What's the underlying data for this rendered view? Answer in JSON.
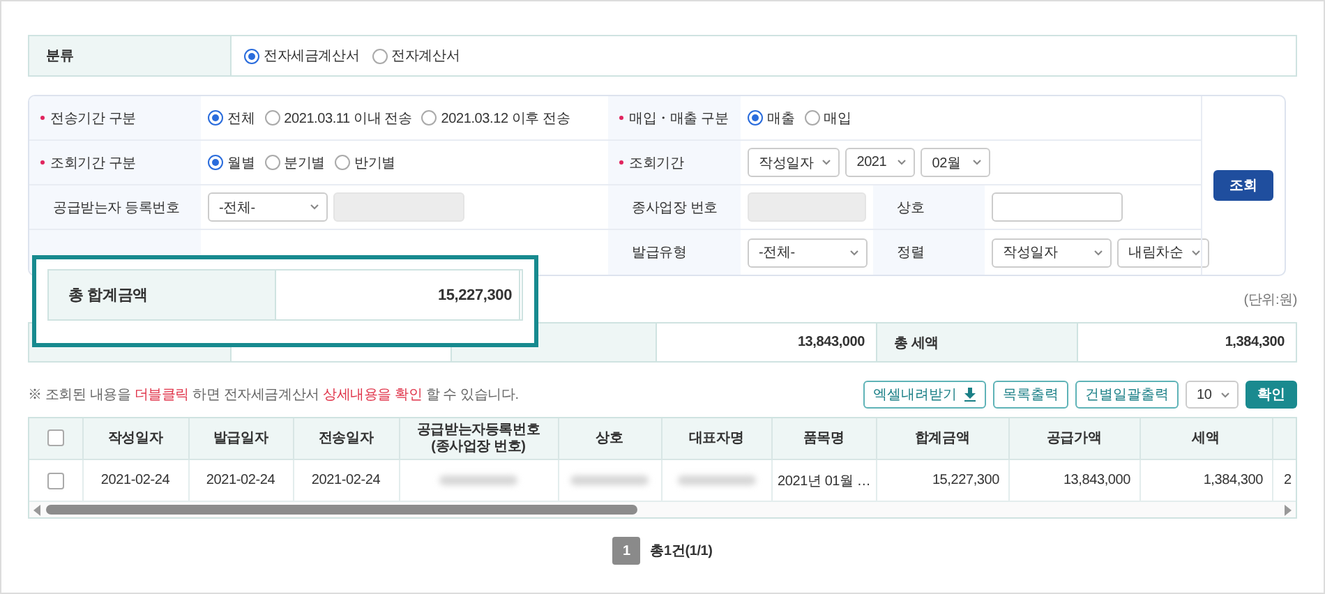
{
  "category": {
    "label": "분류",
    "options": [
      {
        "label": "전자세금계산서",
        "selected": true
      },
      {
        "label": "전자계산서",
        "selected": false
      }
    ]
  },
  "search": {
    "rows": [
      {
        "cells": [
          {
            "kind": "label",
            "text": "전송기간 구분",
            "required": true
          },
          {
            "kind": "value",
            "controls": [
              {
                "kind": "radio",
                "label": "전체",
                "selected": true
              },
              {
                "kind": "radio",
                "label": "2021.03.11 이내 전송",
                "selected": false
              },
              {
                "kind": "radio",
                "label": "2021.03.12 이후 전송",
                "selected": false
              }
            ]
          },
          {
            "kind": "label",
            "text": "매입・매출 구분",
            "required": true
          },
          {
            "kind": "value",
            "controls": [
              {
                "kind": "radio",
                "label": "매출",
                "selected": true
              },
              {
                "kind": "radio",
                "label": "매입",
                "selected": false
              }
            ]
          }
        ]
      },
      {
        "cells": [
          {
            "kind": "label",
            "text": "조회기간 구분",
            "required": true
          },
          {
            "kind": "value",
            "controls": [
              {
                "kind": "radio",
                "label": "월별",
                "selected": true
              },
              {
                "kind": "radio",
                "label": "분기별",
                "selected": false
              },
              {
                "kind": "radio",
                "label": "반기별",
                "selected": false
              }
            ]
          },
          {
            "kind": "label",
            "text": "조회기간",
            "required": true
          },
          {
            "kind": "value",
            "controls": [
              {
                "kind": "select",
                "value": "작성일자"
              },
              {
                "kind": "select",
                "value": "2021"
              },
              {
                "kind": "select",
                "value": "02월"
              }
            ]
          }
        ]
      },
      {
        "cells": [
          {
            "kind": "label",
            "text": "공급받는자 등록번호",
            "required": false
          },
          {
            "kind": "value",
            "controls": [
              {
                "kind": "select",
                "value": "-전체-"
              },
              {
                "kind": "field",
                "disabled": true
              }
            ]
          },
          {
            "kind": "label",
            "text": "종사업장 번호",
            "required": false
          },
          {
            "kind": "value",
            "controls": [
              {
                "kind": "field",
                "disabled": true
              }
            ]
          },
          {
            "kind": "label",
            "text": "상호",
            "required": false
          },
          {
            "kind": "value",
            "controls": [
              {
                "kind": "field",
                "disabled": false
              }
            ]
          }
        ]
      },
      {
        "cells": [
          {
            "kind": "covered"
          },
          {
            "kind": "covered"
          },
          {
            "kind": "label",
            "text": "발급유형",
            "required": false
          },
          {
            "kind": "value",
            "controls": [
              {
                "kind": "select",
                "value": "-전체-"
              }
            ]
          },
          {
            "kind": "label",
            "text": "정렬",
            "required": false
          },
          {
            "kind": "value",
            "controls": [
              {
                "kind": "select",
                "value": "작성일자"
              },
              {
                "kind": "select",
                "value": "내림차순"
              }
            ]
          }
        ]
      }
    ],
    "submit": "조회"
  },
  "unit": "(단위:원)",
  "summary": [
    {
      "kind": "covered"
    },
    {
      "kind": "covered"
    },
    {
      "kind": "covered"
    },
    {
      "kind": "value",
      "text": "13,843,000"
    },
    {
      "kind": "label",
      "text": "총 세액"
    },
    {
      "kind": "value",
      "text": "1,384,300"
    }
  ],
  "notice": [
    {
      "text": "※ 조회된 내용을 ",
      "highlight": false
    },
    {
      "text": "더블클릭",
      "highlight": true
    },
    {
      "text": " 하면 전자세금계산서 ",
      "highlight": false
    },
    {
      "text": "상세내용을 확인",
      "highlight": true
    },
    {
      "text": " 할 수 있습니다.",
      "highlight": false
    }
  ],
  "toolbar": {
    "buttons": [
      {
        "label": "엑셀내려받기",
        "kind": "download"
      },
      {
        "label": "목록출력",
        "kind": "plain"
      },
      {
        "label": "건별일괄출력",
        "kind": "plain"
      }
    ],
    "page_size": "10",
    "confirm": "확인"
  },
  "table": {
    "header_checked": false,
    "columns": [
      "작성일자",
      "발급일자",
      "전송일자",
      "공급받는자등록번호\n(종사업장 번호)",
      "상호",
      "대표자명",
      "품목명",
      "합계금액",
      "공급가액",
      "세액"
    ],
    "rows": [
      {
        "checked": false,
        "cells": [
          {
            "kind": "text",
            "text": "2021-02-24"
          },
          {
            "kind": "text",
            "text": "2021-02-24"
          },
          {
            "kind": "text",
            "text": "2021-02-24"
          },
          {
            "kind": "blurred"
          },
          {
            "kind": "blurred"
          },
          {
            "kind": "blurred"
          },
          {
            "kind": "text",
            "text": "2021년 01월 …"
          },
          {
            "kind": "number",
            "text": "15,227,300"
          },
          {
            "kind": "number",
            "text": "13,843,000"
          },
          {
            "kind": "number",
            "text": "1,384,300"
          },
          {
            "kind": "text",
            "text": "2"
          }
        ]
      }
    ]
  },
  "pagination": {
    "pages": [
      {
        "label": "1",
        "selected": true
      }
    ],
    "summary": "총1건(1/1)"
  },
  "callout": {
    "label": "총 합계금액",
    "value": "15,227,300"
  }
}
